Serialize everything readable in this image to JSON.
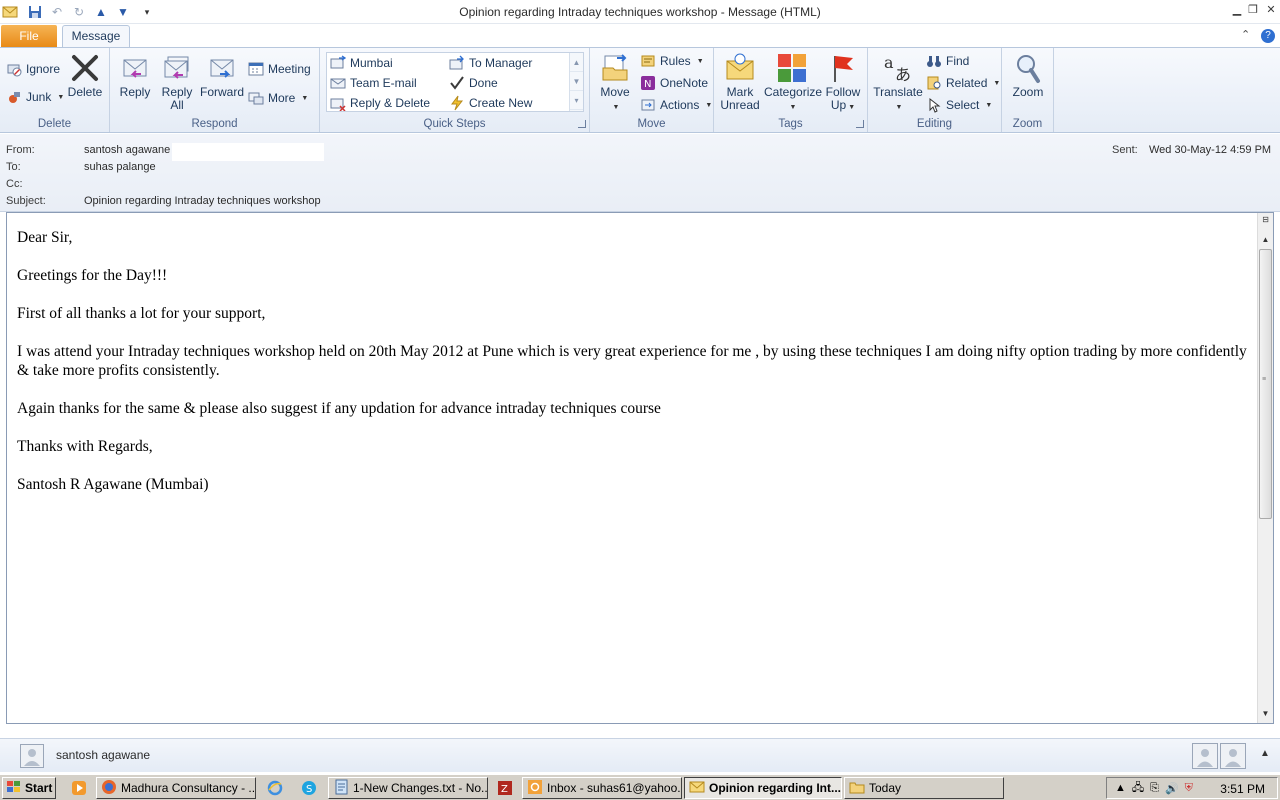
{
  "window": {
    "title": "Opinion regarding Intraday techniques workshop  -  Message (HTML)"
  },
  "tabs": {
    "file": "File",
    "message": "Message"
  },
  "ribbon": {
    "delete_group": {
      "label": "Delete",
      "ignore": "Ignore",
      "junk": "Junk",
      "delete": "Delete"
    },
    "respond_group": {
      "label": "Respond",
      "reply": "Reply",
      "reply_all_1": "Reply",
      "reply_all_2": "All",
      "forward": "Forward",
      "meeting": "Meeting",
      "more": "More"
    },
    "quick_steps": {
      "label": "Quick Steps",
      "items": [
        "Mumbai",
        "Team E-mail",
        "Reply & Delete",
        "To Manager",
        "Done",
        "Create New"
      ]
    },
    "move_group": {
      "label": "Move",
      "move": "Move",
      "rules": "Rules",
      "onenote": "OneNote",
      "actions": "Actions"
    },
    "tags_group": {
      "label": "Tags",
      "mark_unread_1": "Mark",
      "mark_unread_2": "Unread",
      "categorize": "Categorize",
      "follow_up_1": "Follow",
      "follow_up_2": "Up"
    },
    "editing_group": {
      "label": "Editing",
      "translate": "Translate",
      "find": "Find",
      "related": "Related",
      "select": "Select"
    },
    "zoom_group": {
      "label": "Zoom",
      "zoom": "Zoom"
    }
  },
  "header": {
    "from_label": "From:",
    "from_value": "santosh agawane",
    "to_label": "To:",
    "to_value": "suhas palange",
    "cc_label": "Cc:",
    "subject_label": "Subject:",
    "subject_value": "Opinion regarding Intraday techniques workshop",
    "sent_label": "Sent:",
    "sent_value": "Wed 30-May-12 4:59 PM"
  },
  "message": {
    "paragraphs": [
      "Dear Sir,",
      "Greetings for the Day!!!",
      "First of all thanks a lot for your support,",
      "I was attend your Intraday techniques workshop held on 20th May 2012 at Pune which is very great experience for me , by using these techniques I am doing nifty option trading by more confidently & take more profits consistently.",
      "Again thanks for the same & please also suggest if any updation for advance intraday techniques course",
      "Thanks with Regards,",
      "Santosh R Agawane (Mumbai)"
    ]
  },
  "people_pane": {
    "name": "santosh agawane"
  },
  "taskbar": {
    "start": "Start",
    "tasks": [
      "Madhura Consultancy - ...",
      "1-New Changes.txt - No...",
      "Inbox - suhas61@yahoo....",
      "Opinion regarding Int...",
      "Today"
    ],
    "clock": "3:51 PM"
  }
}
